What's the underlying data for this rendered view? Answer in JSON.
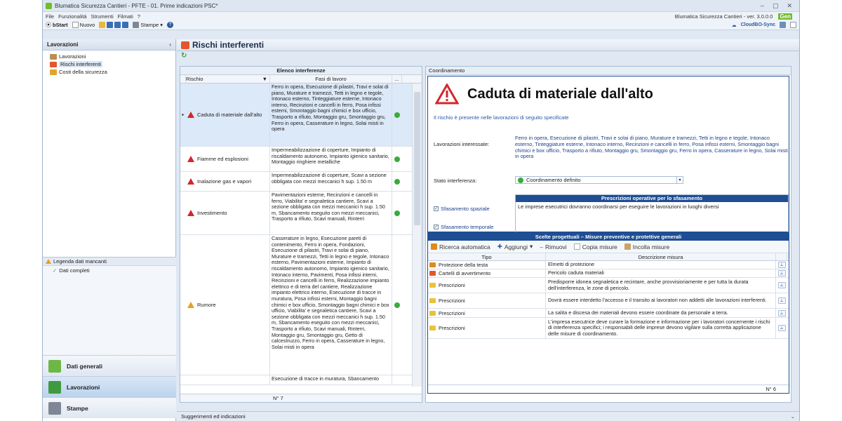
{
  "window": {
    "title": "Blumatica Sicurezza Cantieri - PFTE - 01. Prime indicazioni PSC*",
    "controls": [
      "–",
      "▢",
      "✕"
    ]
  },
  "menu": {
    "items": [
      "File",
      "Funzionalità",
      "Strumenti",
      "Filmati",
      "?"
    ],
    "version": "Blumatica Sicurezza Cantieri - ver. 3.0.0.0",
    "brand": "Gen"
  },
  "toolbar": {
    "bstart": "bStart",
    "nuovo": "Nuovo",
    "stampe": "Stampe",
    "cloud": "CloudBO-Sync"
  },
  "sidebar": {
    "header": "Lavorazioni",
    "collapse": "‹",
    "tree": [
      {
        "label": "Lavorazioni",
        "color": "#b88f52"
      },
      {
        "label": "Rischi interferenti",
        "color": "#e4572e"
      },
      {
        "label": "Costi della sicurezza",
        "color": "#e2a52c"
      }
    ],
    "legend_title": "Legenda dati mancanti",
    "legend_item": "Dati completi",
    "nav": [
      {
        "label": "Dati generali",
        "color": "#6db845"
      },
      {
        "label": "Lavorazioni",
        "color": "#3f9b3f"
      },
      {
        "label": "Stampe",
        "color": "#7f8794"
      }
    ]
  },
  "main": {
    "title": "Rischi interferenti"
  },
  "grid": {
    "title": "Elenco interferenze",
    "col_rischio": "Rischio",
    "col_fasi": "Fasi di lavoro",
    "col_more": "...",
    "count": "N° 7",
    "rows": [
      {
        "rischio": "Caduta di materiale dall'alto",
        "level": "red",
        "fasi": "Ferro in opera, Esecuzione di pilastri, Travi e solai di piano, Murature e tramezzi, Tetti in legno e tegole, Intonaco esterno, Tinteggiature esterne, Intonaco interno, Recinzioni e cancelli in ferro, Posa infissi esterni, Smontaggio bagni chimici e box ufficio, Trasporto a rifiuto, Montaggio gru, Smontaggio gru, Ferro in opera, Casserature in legno, Solai misti in opera"
      },
      {
        "rischio": "Fiamme ed esplosioni",
        "level": "red",
        "fasi": "Impermeabilizzazione di coperture, Impianto di riscaldamento autonomo, Impianto igienico sanitario, Montaggio ringhiere metalliche"
      },
      {
        "rischio": "Inalazione gas e vapori",
        "level": "red",
        "fasi": "Impermeabilizzazione di coperture, Scavi a sezione obbligata con mezzi meccanici h sup. 1.50 m"
      },
      {
        "rischio": "Investimento",
        "level": "red",
        "fasi": "Pavimentazioni esterne, Recinzioni e cancelli in ferro, Viabilita' e segnaletica cantiere, Scavi a sezione obbligata con mezzi meccanici h sup. 1.50 m, Sbancamento eseguito con mezzi meccanici, Trasporto a rifiuto, Scavi manuali, Rinterri"
      },
      {
        "rischio": "Rumore",
        "level": "yellow",
        "fasi": "Casserature in legno, Esecuzione pareti di contenimento, Ferro in opera, Fondazioni, Esecuzione di pilastri, Travi e solai di piano, Murature e tramezzi, Tetti in legno e tegole, Intonaco esterno, Pavimentazioni esterne, Impianto di riscaldamento autonomo, Impianto igienico sanitario, Intonaco interno, Pavimenti, Posa infissi interni, Recinzioni e cancelli in ferro, Realizzazione impianto elettrico e di terra del cantiere, Realizzazione impianto elettrico interno, Esecuzione di tracce in muratura, Posa infissi esterni, Montaggio bagni chimici e box ufficio, Smontaggio bagni chimici e box ufficio, Viabilita' e segnaletica cantiere, Scavi a sezione obbligata con mezzi meccanici h sup. 1.50 m, Sbancamento eseguito con mezzi meccanici, Trasporto a rifiuto, Scavi manuali, Rinterri, Montaggio gru, Smontaggio gru, Getto di calcestruzzo, Ferro in opera, Casserature in legno, Solai misti in opera"
      },
      {
        "rischio": "",
        "level": "",
        "fasi": "Esecuzione di tracce in muratura, Sbancamento"
      }
    ]
  },
  "coord": {
    "tab": "Coordinamento",
    "title": "Caduta di materiale dall'alto",
    "note": "Il rischio è presente nelle lavorazioni di seguito specificate",
    "lav_label": "Lavorazioni interessate:",
    "lav_value": "Ferro in opera, Esecuzione di pilastri, Travi e solai di piano, Murature e tramezzi, Tetti in legno e tegole, Intonaco esterno, Tinteggiature esterne, Intonaco interno, Recinzioni e cancelli in ferro, Posa infissi esterni, Smontaggio bagni chimici e box ufficio, Trasporto a rifiuto, Montaggio gru, Smontaggio gru, Ferro in opera, Casserature in legno, Solai misti in opera",
    "stato_label": "Stato interferenza:",
    "stato_value": "Coordinamento definito",
    "presc_title": "Prescrizioni operative per lo sfasamento",
    "presc_text": "Le imprese esecutrici dovranno coordinarsi per eseguire le lavorazioni in luoghi diversi",
    "sfas_spaziale": "Sfasamento spaziale",
    "sfas_temporale": "Sfasamento temporale"
  },
  "scelte": {
    "title": "Scelte progettuali – Misure preventive e protettive generali",
    "tb": {
      "ricerca": "Ricerca automatica",
      "aggiungi": "Aggiungi",
      "rimuovi": "Rimuovi",
      "copia": "Copia misure",
      "incolla": "Incolla misure"
    },
    "col_tipo": "Tipo",
    "col_desc": "Descrizione misura",
    "count": "N° 6",
    "rows": [
      {
        "tipo": "Protezione della testa",
        "desc": "Elmetti di protezione",
        "color": "#e08a1e"
      },
      {
        "tipo": "Cartelli di avvertimento",
        "desc": "Pericolo caduta materiali",
        "color": "#e4572e"
      },
      {
        "tipo": "Prescrizioni",
        "desc": "Predisporre idonea segnaletica e recintare, anche provvisioriamente e per tutta la durata dell'interferenza, le zone di pericolo.",
        "color": "#e8c33a"
      },
      {
        "tipo": "Prescrizioni",
        "desc": "Dovrà essere interdetto l'accesso e il transito ai lavoratori non addetti alle lavorazioni interferenti.",
        "color": "#e8c33a"
      },
      {
        "tipo": "Prescrizioni",
        "desc": "La salita e discesa dei materiali devono essere coordinate da personale a terra.",
        "color": "#e8c33a"
      },
      {
        "tipo": "Prescrizioni",
        "desc": "L'impresa esecutrice deve curare la formazione e informazione per i lavoratori concernente i rischi di interferenza specifici; i responsabili delle imprese devono vigilare sulla corretta applicazione delle misure di coordinamento.",
        "color": "#e8c33a"
      }
    ]
  },
  "status": {
    "text": "Suggerimenti ed indicazioni",
    "chevron": "⌄"
  }
}
